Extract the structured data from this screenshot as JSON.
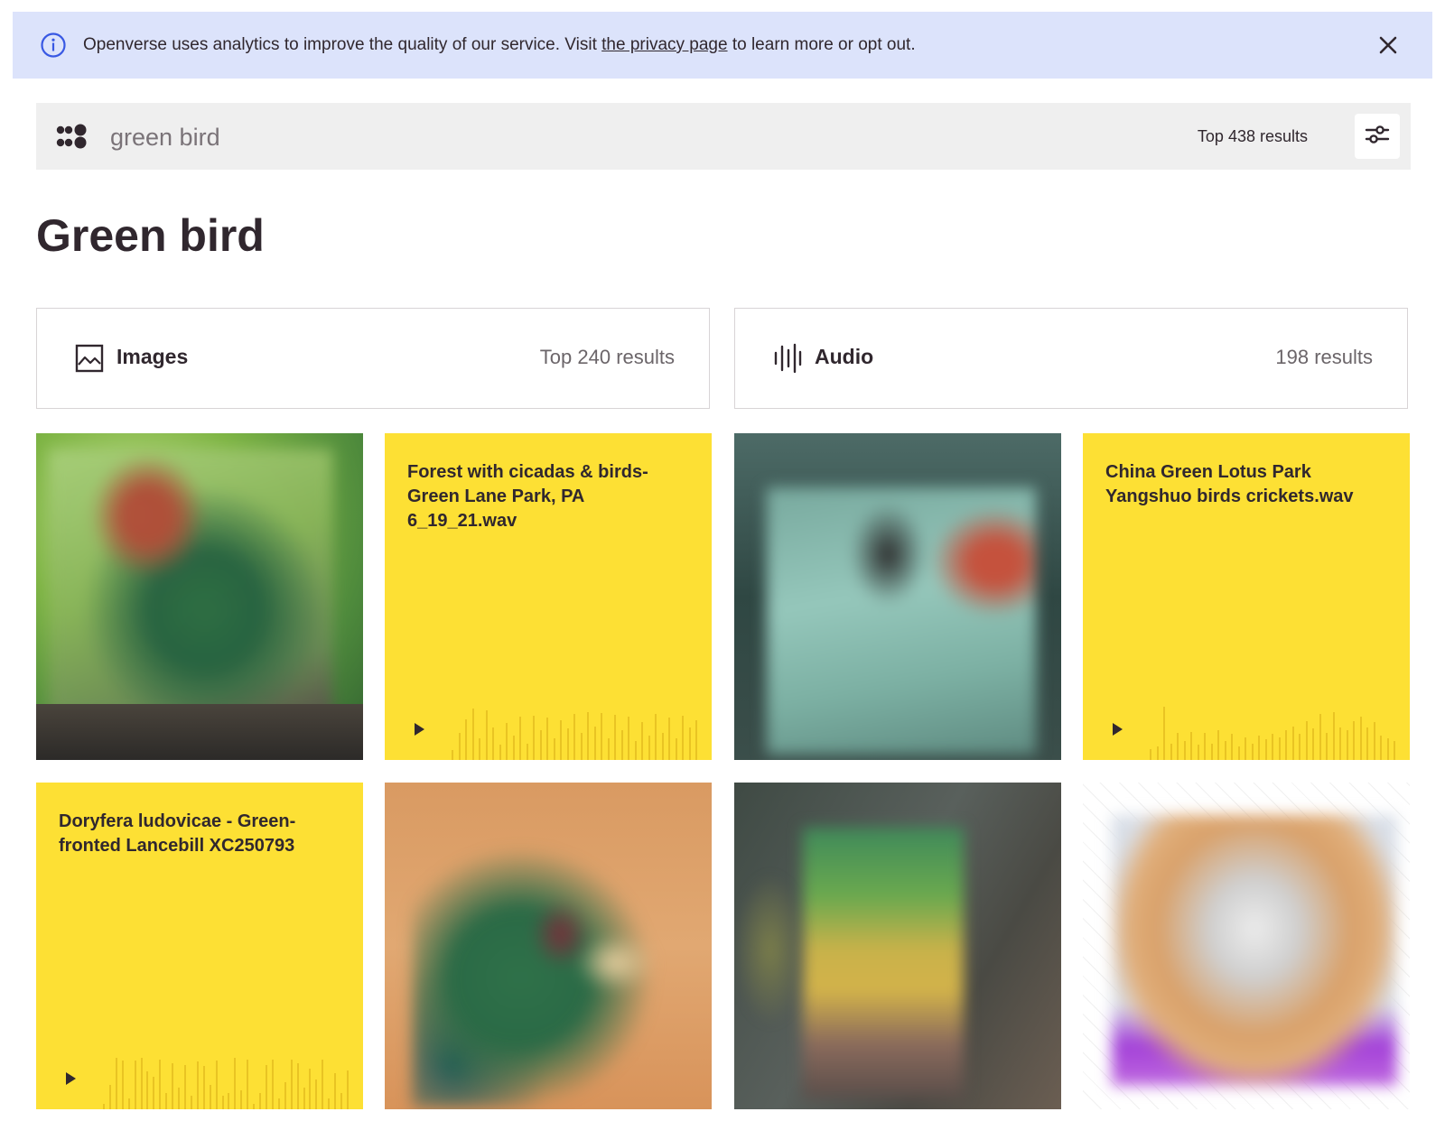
{
  "banner": {
    "text_before": "Openverse uses analytics to improve the quality of our service. Visit ",
    "link_text": "the privacy page",
    "text_after": " to learn more or opt out.",
    "icon": "info-circle-icon",
    "close_icon": "close-icon"
  },
  "search": {
    "value": "green bird",
    "result_count": "Top 438 results",
    "logo_icon": "openverse-logo-icon",
    "filter_icon": "sliders-icon"
  },
  "page": {
    "title": "Green bird"
  },
  "media_types": [
    {
      "label": "Images",
      "count": "Top 240 results",
      "icon": "image-icon"
    },
    {
      "label": "Audio",
      "count": "198 results",
      "icon": "audio-waveform-icon"
    }
  ],
  "audio_results": [
    {
      "title": "Forest with cicadas & birds-Green Lane Park, PA 6_19_21.wav",
      "wave": [
        0.18,
        0.5,
        0.75,
        0.95,
        0.4,
        0.92,
        0.6,
        0.28,
        0.68,
        0.45,
        0.8,
        0.3,
        0.82,
        0.55,
        0.78,
        0.4,
        0.74,
        0.58,
        0.85,
        0.5,
        0.88,
        0.62,
        0.86,
        0.4,
        0.84,
        0.55,
        0.8,
        0.35,
        0.7,
        0.45,
        0.85,
        0.5,
        0.78,
        0.4,
        0.82,
        0.6,
        0.74
      ]
    },
    {
      "title": "China Green Lotus Park Yangshuo birds crickets.wav",
      "wave": [
        0.2,
        0.25,
        0.98,
        0.3,
        0.5,
        0.35,
        0.52,
        0.28,
        0.5,
        0.3,
        0.55,
        0.35,
        0.48,
        0.25,
        0.42,
        0.3,
        0.45,
        0.38,
        0.48,
        0.42,
        0.55,
        0.62,
        0.48,
        0.72,
        0.58,
        0.85,
        0.5,
        0.88,
        0.6,
        0.55,
        0.72,
        0.8,
        0.6,
        0.7,
        0.45,
        0.4,
        0.35
      ]
    },
    {
      "title": "Doryfera ludovicae - Green-fronted Lancebill XC250793",
      "wave": [
        0.1,
        0.45,
        0.95,
        0.9,
        0.2,
        0.9,
        0.95,
        0.7,
        0.6,
        0.92,
        0.3,
        0.85,
        0.4,
        0.82,
        0.25,
        0.88,
        0.8,
        0.45,
        0.9,
        0.25,
        0.3,
        0.95,
        0.35,
        0.92,
        0.1,
        0.3,
        0.82,
        0.92,
        0.2,
        0.5,
        0.92,
        0.85,
        0.4,
        0.75,
        0.55,
        0.92,
        0.2,
        0.66,
        0.3,
        0.72
      ]
    }
  ],
  "image_results": [
    {
      "alt": "blurred image of a bird with green body and red head",
      "colors": [
        "#8fbf4a",
        "#2e6b38",
        "#6aa64c"
      ]
    },
    {
      "alt": "blurred image of a bird in a cage",
      "colors": [
        "#5d8a86",
        "#9cc9c0",
        "#3f5550"
      ]
    },
    {
      "alt": "blurred image of a green turaco on orange background",
      "colors": [
        "#d9955a",
        "#2c6a46",
        "#e8b682"
      ]
    },
    {
      "alt": "blurred image of a colorful bird",
      "colors": [
        "#4a4d48",
        "#b2a14a",
        "#7a6c64"
      ]
    },
    {
      "alt": "blurred diagram with orange and purple colors",
      "colors": [
        "#ffffff",
        "#d99d6a",
        "#a23fd8"
      ]
    }
  ]
}
